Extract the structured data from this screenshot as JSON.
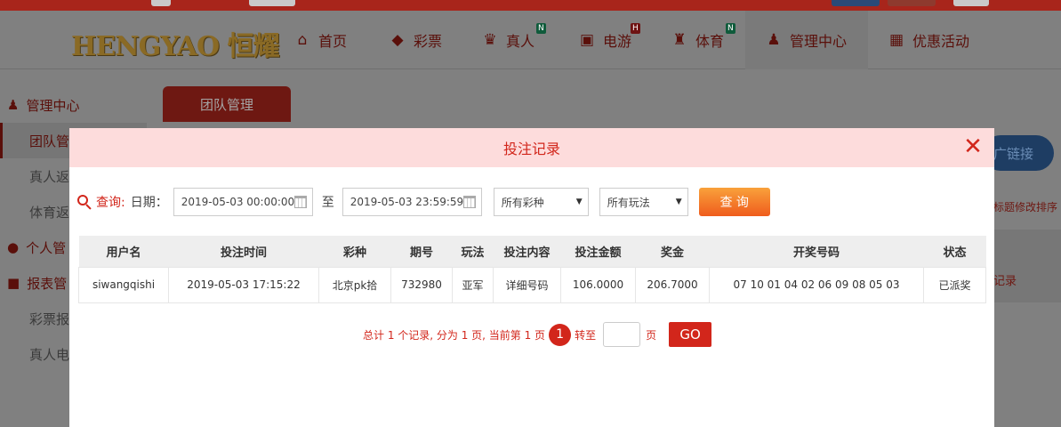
{
  "logo_text": "HENGYAO 恒耀",
  "nav": [
    {
      "label": "首页",
      "icon": "home-icon",
      "glyph": "⌂"
    },
    {
      "label": "彩票",
      "icon": "lottery-icon",
      "glyph": "◆"
    },
    {
      "label": "真人",
      "icon": "live-dealer-icon",
      "glyph": "♛",
      "badge": "N"
    },
    {
      "label": "电游",
      "icon": "slot-game-icon",
      "glyph": "▣",
      "badge": "H"
    },
    {
      "label": "体育",
      "icon": "trophy-icon",
      "glyph": "♜",
      "badge": "N"
    },
    {
      "label": "管理中心",
      "icon": "users-icon",
      "glyph": "♟"
    },
    {
      "label": "优惠活动",
      "icon": "gift-icon",
      "glyph": "▦"
    }
  ],
  "sidebar": {
    "items": [
      {
        "label": "管理中心",
        "glyph": "♟"
      },
      {
        "label": "团队管"
      },
      {
        "label": "真人返"
      },
      {
        "label": "体育返"
      },
      {
        "label": "个人管",
        "glyph": "●"
      },
      {
        "label": "报表管",
        "glyph": "■"
      },
      {
        "label": "彩票报"
      },
      {
        "label": "真人电"
      }
    ]
  },
  "tab_team": "团队管理",
  "bg_right_btn": "广链接",
  "bg_right_text": "标题修改排序",
  "bg_right_link": "记录",
  "modal": {
    "title": "投注记录",
    "close_glyph": "✕",
    "query_label": "查询:",
    "date_label": "日期：",
    "date_from": "2019-05-03 00:00:00",
    "to_label": "至",
    "date_to": "2019-05-03 23:59:59",
    "lottery_select": "所有彩种",
    "play_select": "所有玩法",
    "search_button": "查 询"
  },
  "table": {
    "columns": [
      "用户名",
      "投注时间",
      "彩种",
      "期号",
      "玩法",
      "投注内容",
      "投注金额",
      "奖金",
      "开奖号码",
      "状态"
    ],
    "rows": [
      [
        "siwangqishi",
        "2019-05-03 17:15:22",
        "北京pk拾",
        "732980",
        "亚军",
        "详细号码",
        "106.0000",
        "206.7000",
        "07 10 01 04 02 06 09 08 05 03",
        "已派奖"
      ]
    ]
  },
  "pager": {
    "summary": "总计 1 个记录, 分为 1 页, 当前第 1 页",
    "current_page": "1",
    "goto_label": "转至",
    "page_unit": "页",
    "go_button": "GO"
  },
  "colors": {
    "accent_red": "#d2261b",
    "header_pink": "#fddcdc",
    "search_orange": "#f07c2a",
    "link_green": "#0a8f1c"
  }
}
